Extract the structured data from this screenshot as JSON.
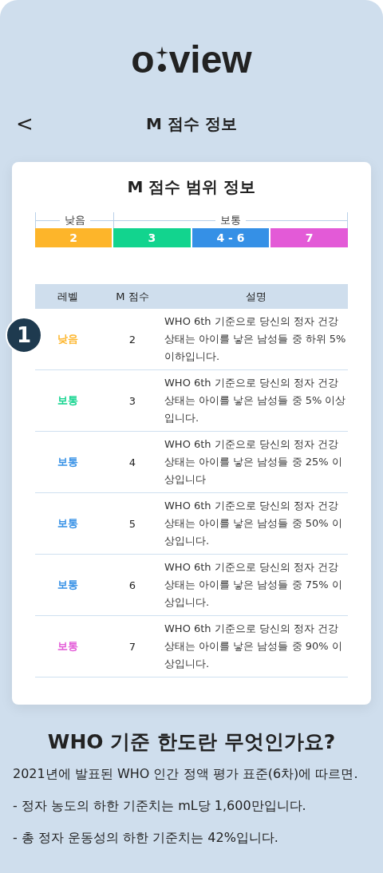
{
  "logo": {
    "left": "o",
    "right": "view"
  },
  "header": {
    "back": "<",
    "title": "M 점수 정보"
  },
  "card": {
    "title": "M 점수 범위 정보",
    "range_groups": [
      {
        "label": "낮음",
        "segments": [
          {
            "label": "2",
            "color": "#fdb52a"
          }
        ]
      },
      {
        "label": "보통",
        "segments": [
          {
            "label": "3",
            "color": "#12d48e"
          },
          {
            "label": "4 - 6",
            "color": "#3590e6"
          },
          {
            "label": "7",
            "color": "#e35ad7"
          }
        ]
      }
    ],
    "table": {
      "columns": [
        "레벨",
        "M 점수",
        "설명"
      ],
      "rows": [
        {
          "level": "낮음",
          "color": "#fdb52a",
          "score": "2",
          "description": "WHO 6th 기준으로 당신의 정자 건강상태는 아이를 낳은 남성들 중 하위 5% 이하입니다.",
          "badge": "1"
        },
        {
          "level": "보통",
          "color": "#12d48e",
          "score": "3",
          "description": "WHO 6th 기준으로 당신의 정자 건강상태는 아이를 낳은 남성들 중 5% 이상입니다."
        },
        {
          "level": "보통",
          "color": "#3590e6",
          "score": "4",
          "description": "WHO 6th 기준으로 당신의 정자 건강상태는 아이를 낳은 남성들 중 25% 이상입니다"
        },
        {
          "level": "보통",
          "color": "#3590e6",
          "score": "5",
          "description": "WHO 6th 기준으로 당신의 정자 건강상태는 아이를 낳은 남성들 중 50% 이상입니다."
        },
        {
          "level": "보통",
          "color": "#3590e6",
          "score": "6",
          "description": "WHO 6th 기준으로 당신의 정자 건강상태는 아이를 낳은 남성들 중 75% 이상입니다."
        },
        {
          "level": "보통",
          "color": "#e35ad7",
          "score": "7",
          "description": "WHO 6th 기준으로 당신의 정자 건강상태는 아이를 낳은 남성들 중 90% 이상입니다."
        }
      ]
    }
  },
  "info": {
    "title": "WHO 기준 한도란 무엇인가요?",
    "paragraphs": [
      "2021년에 발표된 WHO 인간 정액 평가 표준(6차)에 따르면.",
      "- 정자 농도의 하한 기준치는 mL당 1,600만입니다.",
      "- 총 정자 운동성의 하한 기준치는 42%입니다."
    ]
  }
}
